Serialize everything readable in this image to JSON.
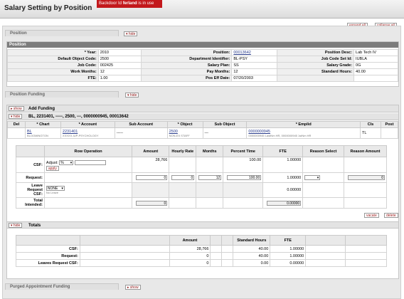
{
  "page": {
    "title": "Salary Setting by Position",
    "lock_prefix": "Backdoor Id ",
    "lock_user": "ferland",
    "lock_suffix": " is in use"
  },
  "top_buttons": {
    "expand": "expand all",
    "collapse": "collapse all"
  },
  "position_tab": {
    "label": "Position",
    "toggle": "▾ hide"
  },
  "position": {
    "header": "Position",
    "rows": [
      [
        {
          "label": "* Year:",
          "value": "2010"
        },
        {
          "label": "Position:",
          "value": "00013642",
          "link": true
        },
        {
          "label": "Position Desc:",
          "value": "Lab Tech IV"
        }
      ],
      [
        {
          "label": "Default Object Code:",
          "value": "2500"
        },
        {
          "label": "Department Identifier:",
          "value": "BL-PSY"
        },
        {
          "label": "Job Code Set Id:",
          "value": "IUBLA"
        }
      ],
      [
        {
          "label": "Job Code:",
          "value": "002425"
        },
        {
          "label": "Salary Plan:",
          "value": "SS"
        },
        {
          "label": "Salary Grade:",
          "value": "0G"
        }
      ],
      [
        {
          "label": "Work Months:",
          "value": "12"
        },
        {
          "label": "Pay Months:",
          "value": "12"
        },
        {
          "label": "Standard Hours:",
          "value": "40.00"
        }
      ],
      [
        {
          "label": "FTE:",
          "value": "1.00"
        },
        {
          "label": "Pos Eff Date:",
          "value": "07/20/2003"
        },
        {
          "label": "",
          "value": ""
        }
      ]
    ]
  },
  "funding_tab": {
    "label": "Position Funding",
    "toggle": "▾ hide"
  },
  "add_funding": {
    "toggle": "▸ show",
    "label": "Add Funding"
  },
  "line": {
    "toggle": "▾ hide",
    "title": "BL, 2231401, -----, 2500, ---, 0000000945, 00013642"
  },
  "line_headers": [
    "Del",
    "* Chart",
    "* Account",
    "Sub Account",
    "* Object",
    "Sub Object",
    "* Emplid",
    "Cls",
    "Post"
  ],
  "line_values": {
    "chart": "BL",
    "chart_sub": "BLOOMINGTON",
    "account": "2231401",
    "account_sub": "XXXXX-IUP-PSYCHOLOGY",
    "sub_account": "-----",
    "object": "2500",
    "object_sub": "NON-EX STAFF",
    "sub_object": "---",
    "emplid": "0000000945",
    "emplid_sub": "0000000945 LastNm HR, 0000000945 1stNm HR",
    "cls": "TL",
    "post": ""
  },
  "detail_headers": [
    "Row Operation",
    "Amount",
    "Hourly Rate",
    "Months",
    "Percent Time",
    "FTE",
    "Reason Select",
    "Reason Amount"
  ],
  "csf": {
    "label": "CSF:",
    "adjust_label": "Adjust:",
    "adjust_select": "%",
    "apply": "apply",
    "amount": "28,766",
    "percent": "100.00",
    "fte": "1.00000"
  },
  "request": {
    "label": "Request:",
    "amount": "0",
    "hourly": "0",
    "months": "12",
    "percent": "100.00",
    "fte": "1.00000",
    "reason_amount": "0"
  },
  "leave": {
    "label": "Leave Request CSF:",
    "select": "NONE",
    "note": "No Leave",
    "fte": "0.00000"
  },
  "total_intended": {
    "label": "Total Intended:",
    "amount": "0",
    "fte": "0.00000"
  },
  "line_buttons": {
    "vacate": "vacate",
    "delete": "delete"
  },
  "totals": {
    "toggle": "▾ hide",
    "label": "Totals",
    "headers": [
      "Amount",
      "Standard Hours",
      "FTE"
    ],
    "rows": [
      {
        "label": "CSF:",
        "amount": "28,766",
        "hours": "40.00",
        "fte": "1.00000"
      },
      {
        "label": "Request:",
        "amount": "0",
        "hours": "40.00",
        "fte": "1.00000"
      },
      {
        "label": "Leaves Request CSF:",
        "amount": "0",
        "hours": "0.00",
        "fte": "0.00000"
      }
    ]
  },
  "purged_tab": {
    "label": "Purged Appointment Funding",
    "toggle": "▸ show"
  }
}
